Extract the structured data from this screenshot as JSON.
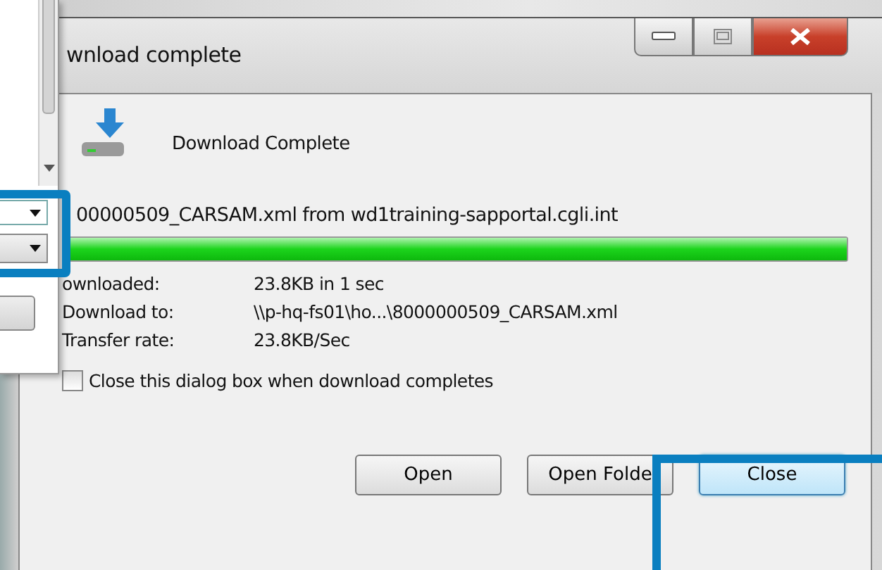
{
  "window": {
    "title": "wnload complete"
  },
  "heading": "Download Complete",
  "source": "00000509_CARSAM.xml from wd1training-sapportal.cgli.int",
  "progress": {
    "level": 1
  },
  "details": [
    {
      "label": "ownloaded:",
      "value": "23.8KB in 1 sec"
    },
    {
      "label": "Download to:",
      "value": "\\\\p-hq-fs01\\ho...\\8000000509_CARSAM.xml"
    },
    {
      "label": "Transfer rate:",
      "value": "23.8KB/Sec"
    }
  ],
  "close_when_done": {
    "label": "Close this dialog box when download completes",
    "checked": false
  },
  "buttons": [
    {
      "label": "Open",
      "default": false
    },
    {
      "label": "Open Folde",
      "default": false
    },
    {
      "label": "Close",
      "default": true
    }
  ]
}
